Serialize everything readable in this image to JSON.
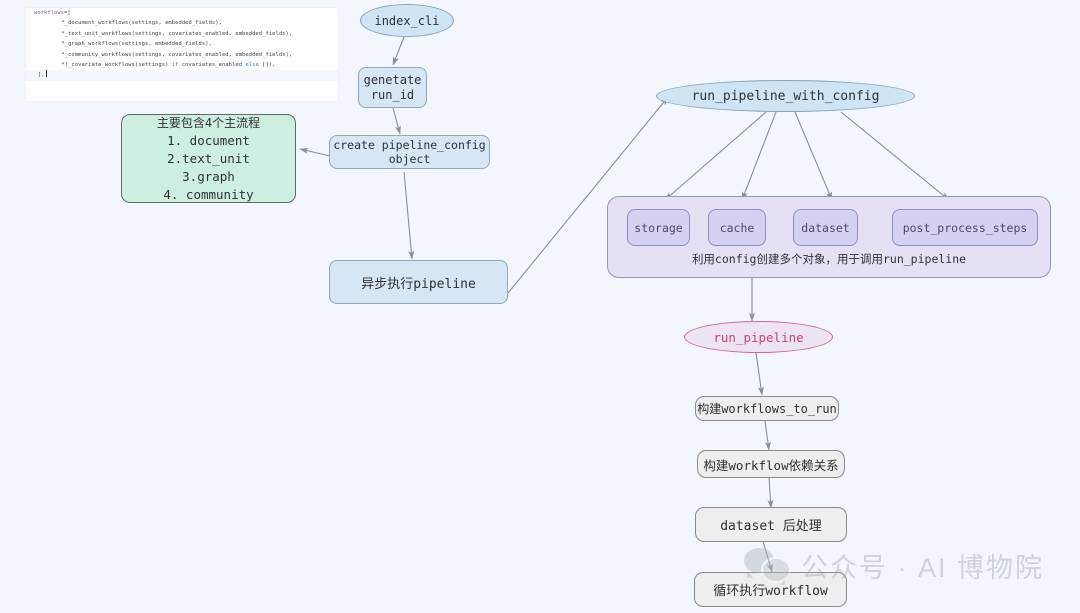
{
  "diagram": {
    "background_color": "#f3f6fd",
    "code_panel": {
      "lines": [
        "workflows=[",
        "    *_document_workflows(settings, embedded_fields),",
        "    *_text_unit_workflows(settings, covariates_enabled, embedded_fields),",
        "    *_graph_workflows(settings, embedded_fields),",
        "    *_community_workflows(settings, covariates_enabled, embedded_fields),",
        "    *(_covariate_workflows(settings) if covariates_enabled else []),",
        "],"
      ],
      "line1_keyword": "workflows",
      "line1_rest": "=[",
      "line6_a": "    *(_covariate_workflows(settings) ",
      "line6_if": "if",
      "line6_b": " covariates_enabled ",
      "line6_else": "else",
      "line6_c": " []),",
      "line7": "],"
    },
    "note_green": {
      "title": "主要包含4个主流程",
      "items": [
        "1. document",
        "2.text_unit",
        "3.graph",
        "4. community"
      ]
    },
    "nodes": {
      "index_cli": "index_cli",
      "generate_run_id": "genetate\nrun_id",
      "create_pipeline_config": "create pipeline_config\nobject",
      "async_run_pipeline": "异步执行pipeline",
      "run_pipeline_with_config": "run_pipeline_with_config",
      "run_pipeline": "run_pipeline",
      "build_workflows_to_run": "构建workflows_to_run",
      "build_workflow_deps": "构建workflow依赖关系",
      "dataset_post_process": "dataset 后处理",
      "loop_run_workflow": "循环执行workflow"
    },
    "config_group": {
      "items": [
        "storage",
        "cache",
        "dataset",
        "post_process_steps"
      ],
      "caption": "利用config创建多个对象，用于调用run_pipeline"
    },
    "watermark": {
      "text": "公众号 · AI 博物院",
      "icon": "wechat-logo"
    },
    "colors": {
      "blue_fill": "#d6e6f5",
      "green_fill": "#cdefe0",
      "lavender_fill": "#e6e0f5",
      "lavender_item_fill": "#d4d2f0",
      "pink_stroke": "#d4688f",
      "gray_fill": "#eeeeee",
      "edge_stroke": "#8a8f96"
    }
  }
}
